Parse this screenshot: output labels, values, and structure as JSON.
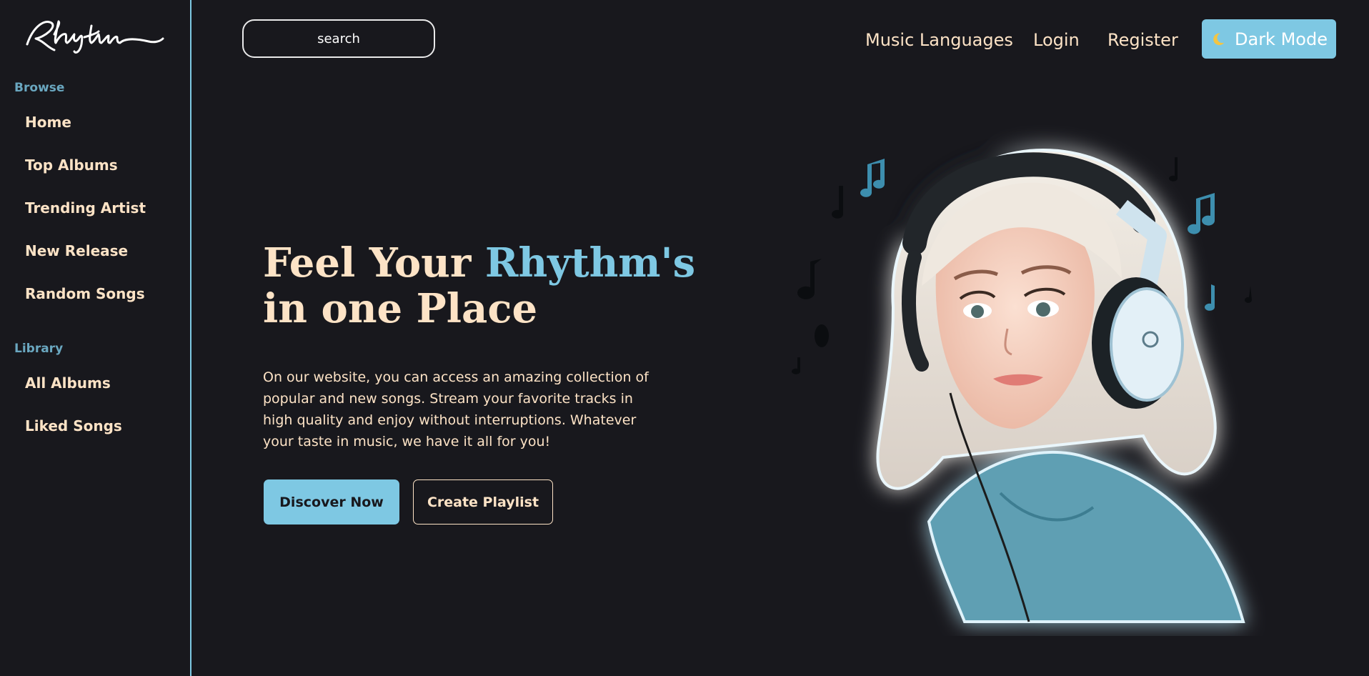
{
  "sidebar": {
    "logo_text": "Rhythm",
    "sections": [
      {
        "title": "Browse",
        "items": [
          "Home",
          "Top Albums",
          "Trending Artist",
          "New Release",
          "Random Songs"
        ]
      },
      {
        "title": "Library",
        "items": [
          "All Albums",
          "Liked Songs"
        ]
      }
    ]
  },
  "header": {
    "search_placeholder": "search",
    "nav": [
      "Music Languages",
      "Login",
      "Register"
    ],
    "dark_mode_label": "Dark Mode",
    "dark_mode_icon": "moon-icon"
  },
  "hero": {
    "title_part1": "Feel Your ",
    "title_accent": "Rhythm's",
    "title_part2": "in one Place",
    "description": "On our website, you can access an amazing collection of popular and new songs. Stream your favorite tracks in high quality and enjoy without interruptions. Whatever your taste in music, we have it all for you!",
    "primary_button": "Discover Now",
    "secondary_button": "Create Playlist",
    "illustration": "girl-with-headphones-illustration"
  },
  "colors": {
    "background": "#18181d",
    "accent": "#7ec8e3",
    "text": "#fde3c6",
    "section_title": "#6aa7c0"
  }
}
